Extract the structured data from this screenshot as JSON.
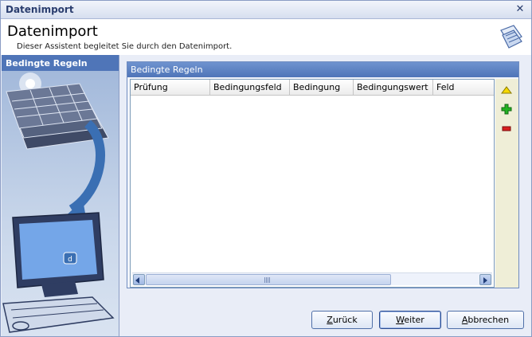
{
  "window": {
    "title": "Datenimport"
  },
  "header": {
    "title": "Datenimport",
    "subtitle": "Dieser Assistent begleitet Sie durch den Datenimport."
  },
  "left_panel": {
    "title": "Bedingte Regeln"
  },
  "group": {
    "title": "Bedingte Regeln",
    "columns": [
      "Prüfung",
      "Bedingungsfeld",
      "Bedingung",
      "Bedingungswert",
      "Feld"
    ]
  },
  "tools": {
    "up": "up-arrow-icon",
    "add": "add-icon",
    "remove": "remove-icon"
  },
  "buttons": {
    "back": {
      "first": "Z",
      "rest": "urück"
    },
    "next": {
      "first": "W",
      "rest": "eiter"
    },
    "cancel": {
      "first": "A",
      "rest": "bbrechen"
    }
  },
  "colors": {
    "accent": "#4f75b8",
    "tool_panel": "#efeed7",
    "add": "#22b322",
    "remove": "#d81e1e",
    "up": "#f5d800"
  }
}
